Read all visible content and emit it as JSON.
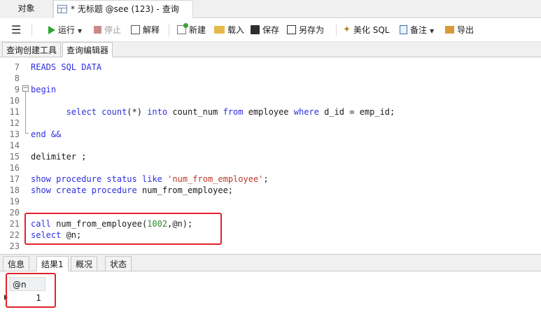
{
  "doc_tabs": {
    "objects": "对象",
    "query_tab": "* 无标题 @see (123) - 查询"
  },
  "toolbar": {
    "run": "运行",
    "stop": "停止",
    "explain": "解释",
    "new": "新建",
    "load": "载入",
    "save": "保存",
    "save_as": "另存为",
    "beautify": "美化 SQL",
    "notes": "备注",
    "export": "导出"
  },
  "sub_tabs": {
    "builder": "查询创建工具",
    "editor": "查询编辑器"
  },
  "editor": {
    "lines": [
      {
        "n": "7",
        "t": "READS SQL DATA"
      },
      {
        "n": "8",
        "t": ""
      },
      {
        "n": "9",
        "t": "begin"
      },
      {
        "n": "10",
        "t": ""
      },
      {
        "n": "11",
        "t": "       select count(*) into count_num from employee where d_id = emp_id;"
      },
      {
        "n": "12",
        "t": ""
      },
      {
        "n": "13",
        "t": "end &&"
      },
      {
        "n": "14",
        "t": ""
      },
      {
        "n": "15",
        "t": "delimiter ;"
      },
      {
        "n": "16",
        "t": ""
      },
      {
        "n": "17",
        "t": "show procedure status like 'num_from_employee';"
      },
      {
        "n": "18",
        "t": "show create procedure num_from_employee;"
      },
      {
        "n": "19",
        "t": ""
      },
      {
        "n": "20",
        "t": ""
      },
      {
        "n": "21",
        "t": "call num_from_employee(1002,@n);"
      },
      {
        "n": "22",
        "t": "select @n;"
      },
      {
        "n": "23",
        "t": ""
      }
    ]
  },
  "result_tabs": [
    "信息",
    "结果1",
    "概况",
    "状态"
  ],
  "result_grid": {
    "column": "@n",
    "value": "1"
  }
}
